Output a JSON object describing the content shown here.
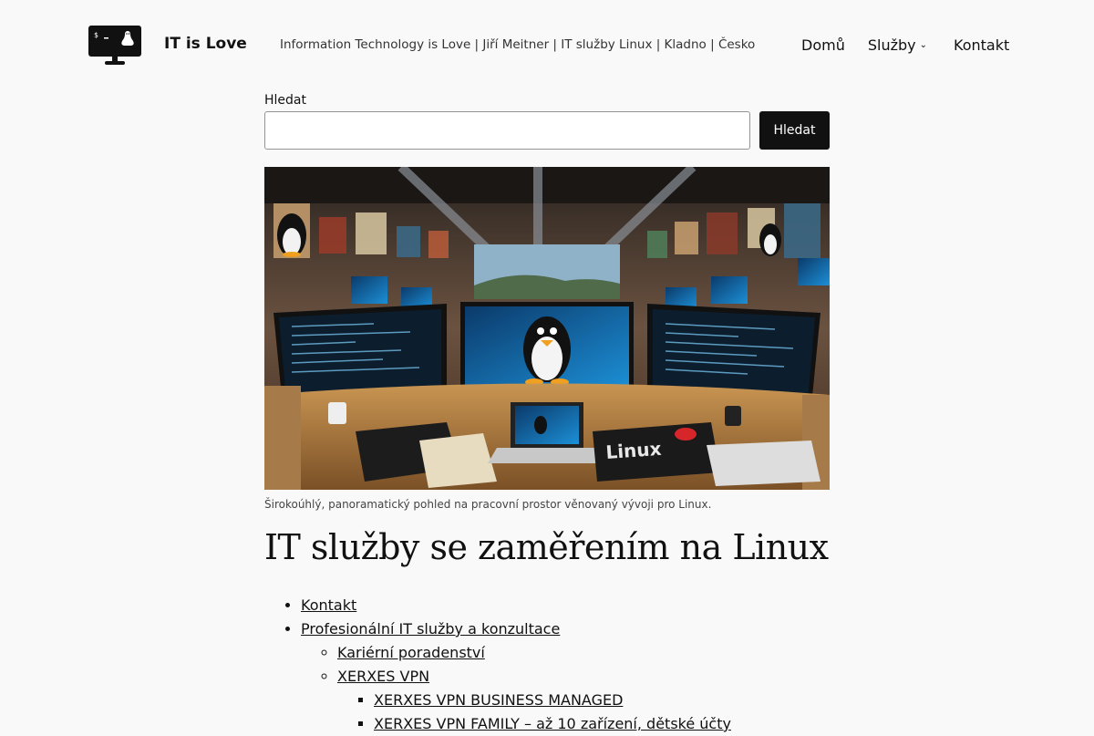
{
  "site": {
    "title": "IT is Love",
    "tagline": "Information Technology is Love | Jiří Meitner | IT služby Linux | Kladno | Česko"
  },
  "nav": {
    "home": "Domů",
    "services": "Služby",
    "contact": "Kontakt"
  },
  "search": {
    "label": "Hledat",
    "placeholder": "",
    "button": "Hledat"
  },
  "hero": {
    "caption": "Širokoúhlý, panoramatický pohled na pracovní prostor věnovaný vývoji pro Linux.",
    "mousepad_text": "Linux"
  },
  "main": {
    "heading": "IT služby se zaměřením na Linux",
    "links": [
      "Kontakt",
      "Profesionální IT služby a konzultace",
      "Kariérní poradenství",
      "XERXES VPN",
      "XERXES VPN BUSINESS MANAGED",
      "XERXES VPN FAMILY – až 10 zařízení, dětské účty"
    ]
  }
}
